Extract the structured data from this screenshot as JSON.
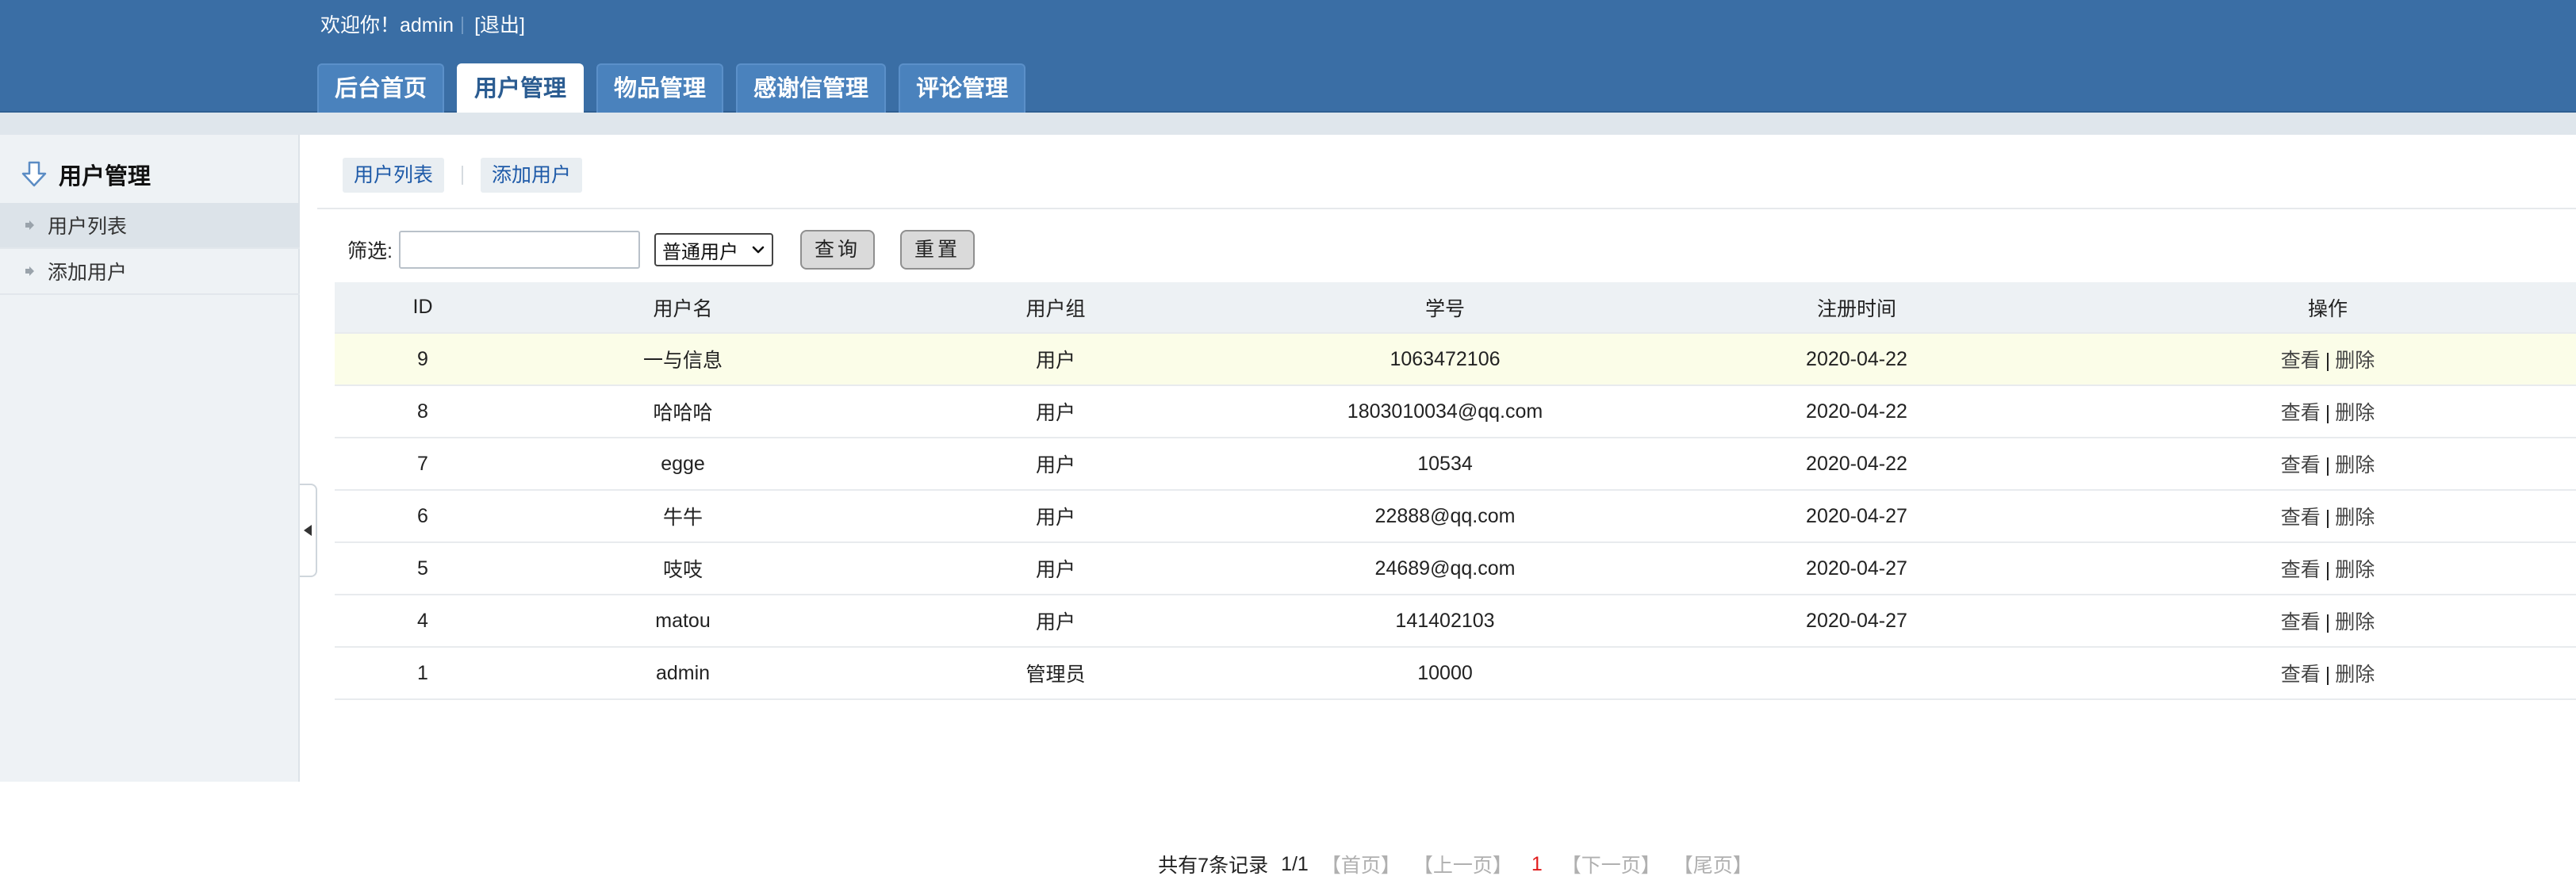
{
  "header": {
    "welcome": "欢迎你！admin",
    "logout": "[退出]",
    "tabs": [
      {
        "label": "后台首页"
      },
      {
        "label": "用户管理"
      },
      {
        "label": "物品管理"
      },
      {
        "label": "感谢信管理"
      },
      {
        "label": "评论管理"
      }
    ],
    "active_tab": "用户管理"
  },
  "sidebar": {
    "title": "用户管理",
    "items": [
      {
        "label": "用户列表"
      },
      {
        "label": "添加用户"
      }
    ]
  },
  "main": {
    "subtabs": [
      {
        "label": "用户列表"
      },
      {
        "label": "添加用户"
      }
    ],
    "filter": {
      "label": "筛选:",
      "input_value": "",
      "select_value": "普通用户",
      "query_label": "查询",
      "reset_label": "重置"
    },
    "table": {
      "columns": [
        "ID",
        "用户名",
        "用户组",
        "学号",
        "注册时间",
        "操作"
      ],
      "rows": [
        {
          "id": "9",
          "name": "一与信息",
          "group": "用户",
          "sid": "1063472106",
          "date": "2020-04-22",
          "view": "查看",
          "del": "删除"
        },
        {
          "id": "8",
          "name": "哈哈哈",
          "group": "用户",
          "sid": "1803010034@qq.com",
          "date": "2020-04-22",
          "view": "查看",
          "del": "删除"
        },
        {
          "id": "7",
          "name": "egge",
          "group": "用户",
          "sid": "10534",
          "date": "2020-04-22",
          "view": "查看",
          "del": "删除"
        },
        {
          "id": "6",
          "name": "牛牛",
          "group": "用户",
          "sid": "22888@qq.com",
          "date": "2020-04-27",
          "view": "查看",
          "del": "删除"
        },
        {
          "id": "5",
          "name": "吱吱",
          "group": "用户",
          "sid": "24689@qq.com",
          "date": "2020-04-27",
          "view": "查看",
          "del": "删除"
        },
        {
          "id": "4",
          "name": "matou",
          "group": "用户",
          "sid": "141402103",
          "date": "2020-04-27",
          "view": "查看",
          "del": "删除"
        },
        {
          "id": "1",
          "name": "admin",
          "group": "管理员",
          "sid": "10000",
          "date": "",
          "view": "查看",
          "del": "删除"
        }
      ],
      "op_separator": "|"
    },
    "pager": {
      "total": "共有7条记录",
      "page": "1/1",
      "first": "【首页】",
      "prev": "【上一页】",
      "current": "1",
      "next": "【下一页】",
      "last": "【尾页】"
    }
  },
  "colors": {
    "header_bg": "#3a6ea5",
    "tab_bg": "#4a82bd",
    "link": "#1e5aa8",
    "highlight_row": "#fbfde8",
    "current_page": "#e11b1b"
  }
}
